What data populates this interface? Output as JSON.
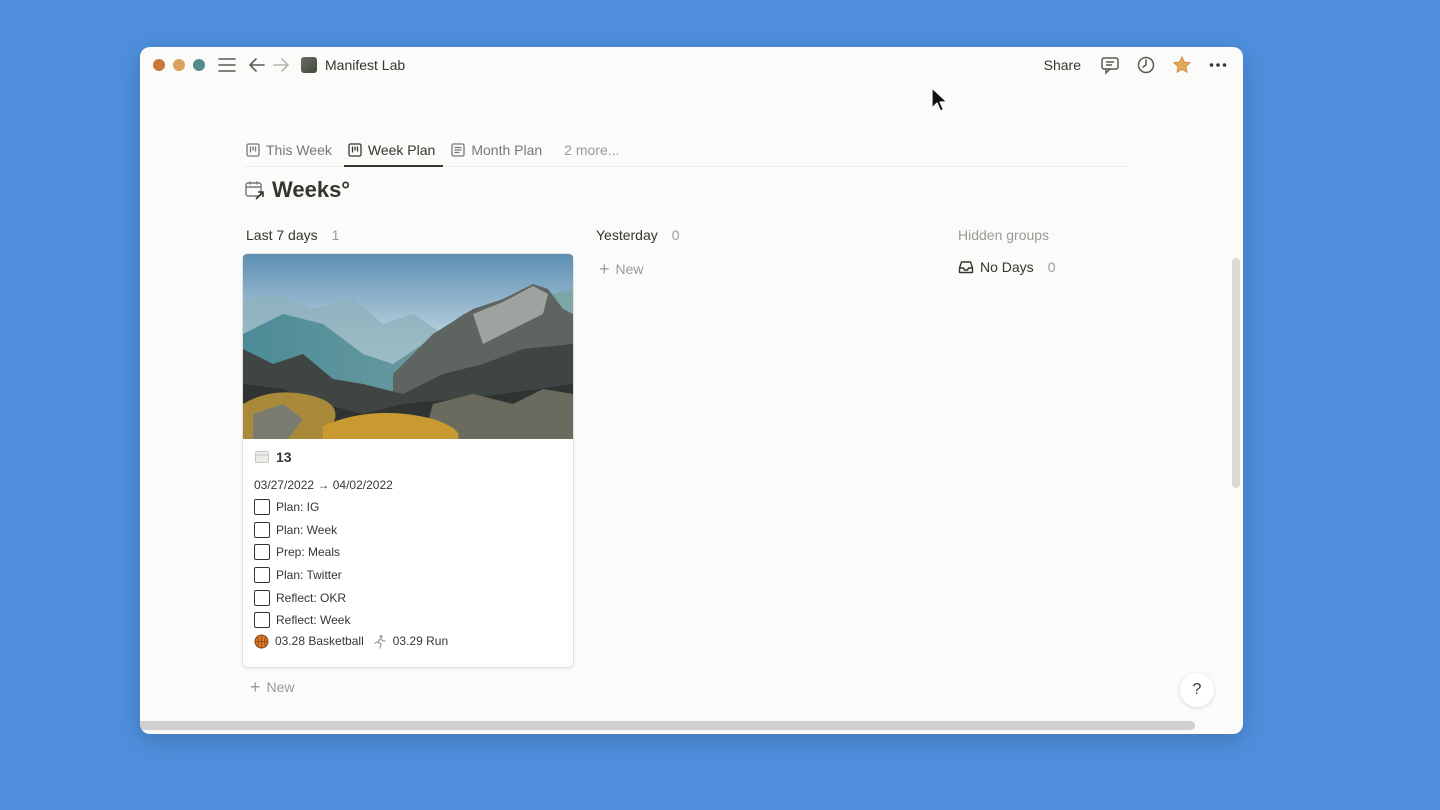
{
  "window": {
    "traffic_colors": [
      "#c9783c",
      "#d9a25e",
      "#4f8c8a"
    ],
    "breadcrumb": "Manifest Lab",
    "share_label": "Share"
  },
  "tabs": [
    {
      "label": "This Week",
      "icon": "board-icon",
      "active": false
    },
    {
      "label": "Week Plan",
      "icon": "board-icon",
      "active": true
    },
    {
      "label": "Month Plan",
      "icon": "list-icon",
      "active": false
    }
  ],
  "tabs_more": "2 more...",
  "database": {
    "title": "Weeks°",
    "icon": "calendar-link-icon"
  },
  "groups": [
    {
      "name": "Last 7 days",
      "count": "1"
    },
    {
      "name": "Yesterday",
      "count": "0"
    }
  ],
  "card": {
    "title": "13",
    "date_range": "03/27/2022 → 04/02/2022",
    "todos": [
      "Plan: IG",
      "Plan: Week",
      "Prep: Meals",
      "Plan: Twitter",
      "Reflect: OKR",
      "Reflect: Week"
    ],
    "relations": [
      {
        "label": "03.28 Basketball",
        "icon": "basketball-icon"
      },
      {
        "label": "03.29 Run",
        "icon": "runner-icon"
      }
    ]
  },
  "new_label": "New",
  "hidden_groups": {
    "heading": "Hidden groups",
    "items": [
      {
        "name": "No Days",
        "count": "0"
      }
    ]
  },
  "help_label": "?"
}
